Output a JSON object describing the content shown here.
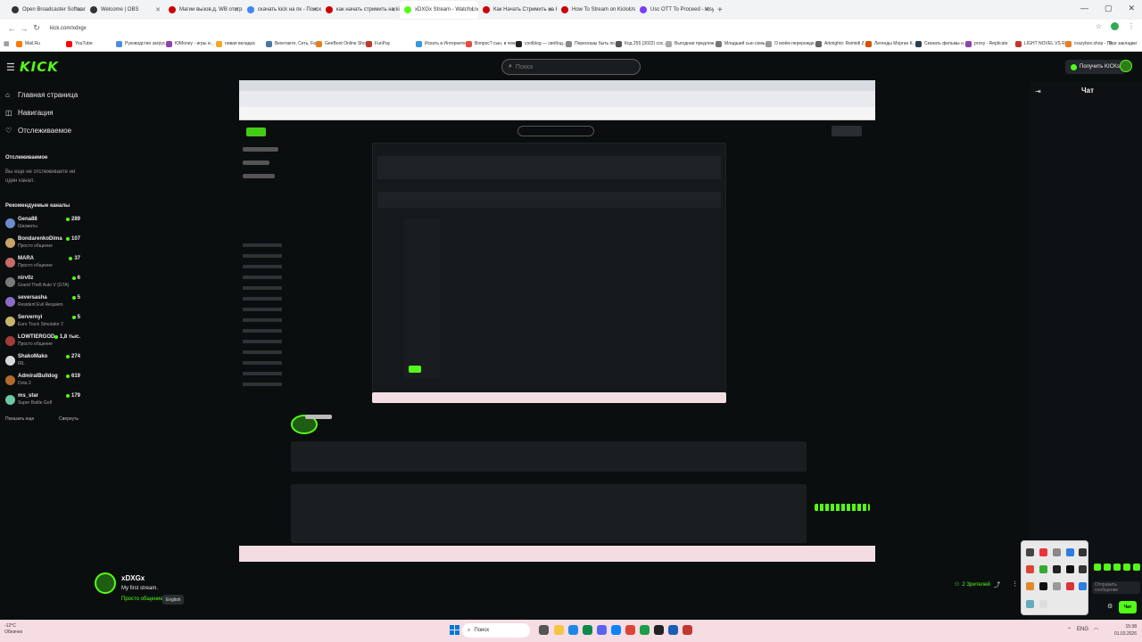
{
  "browser": {
    "tabs": [
      {
        "label": "Open Broadcaster Software | O",
        "favicon_color": "#333333"
      },
      {
        "label": "Welcome | OBS",
        "favicon_color": "#333333"
      },
      {
        "label": "Магии вызов.д. WB отстранен",
        "favicon_color": "#cc0000"
      },
      {
        "label": "скачать kick на пк - Поиск в G",
        "favicon_color": "#4285f4"
      },
      {
        "label": "как начать стримить на kick",
        "favicon_color": "#cc0000"
      },
      {
        "label": "xDXGx Stream - Watch Live",
        "favicon_color": "#53fc18",
        "active": true
      },
      {
        "label": "Как Начать Стримить на Kick",
        "favicon_color": "#cc0000"
      },
      {
        "label": "How To Stream on Kick Using",
        "favicon_color": "#cc0000"
      },
      {
        "label": "Usc OTT To Proceed - ktsyuy",
        "favicon_color": "#7a3cff"
      }
    ],
    "url": "kick.com/xdxgx",
    "bookmarks": [
      "Mail.Ru",
      "YouTube",
      "Руководство загрус...",
      "ЮMoney - игры и...",
      "новая вкладка",
      "Вконтакте, Сеть, Fa...",
      "GeeBoot Online Sho...",
      "FunPay",
      "Искать в Интернете",
      "Вопрос? сын, в чем...",
      "coolblog — свобод...",
      "Пересказы быть по...",
      "Код 255 (3022) сос...",
      "Выгодная предлож...",
      "Младший сын семь...",
      "О моём перерожде...",
      "Arknights: Reimidi Z...",
      "Легенды Морган К...",
      "Скачать фильмы н...",
      "proxy - Replicate",
      "LIGHT NOVEL VS R...",
      "crazybox.shop - По..."
    ],
    "bookmark_colors": [
      "#ff7a00",
      "#ff0000",
      "#4a90d9",
      "#8e44ad",
      "#f5a623",
      "#4a76a8",
      "#e67e22",
      "#c0392b",
      "#3498db",
      "#e74c3c",
      "#222222",
      "#888888",
      "#555555",
      "#aaaaaa",
      "#777777",
      "#999999",
      "#666666",
      "#d35400",
      "#2c3e50",
      "#8e44ad",
      "#c0392b",
      "#e67e22"
    ],
    "all_bookmarks": "Все закладки"
  },
  "kick": {
    "logo": "KICK",
    "search_placeholder": "Поиск",
    "get_kicks": "Получить KICKs",
    "accent": "#53fc18",
    "nav": [
      {
        "label": "Главная страница",
        "icon": "home-icon",
        "glyph": "⌂"
      },
      {
        "label": "Навигация",
        "icon": "compass-icon",
        "glyph": "◫"
      },
      {
        "label": "Отслеживаемое",
        "icon": "heart-icon",
        "glyph": "♡"
      }
    ],
    "following_heading": "Отслеживаемое",
    "following_empty": "Вы еще не отслеживаете ни один канал.",
    "recommended_heading": "Рекомендуемые каналы",
    "recommended": [
      {
        "name": "Gena88",
        "category": "Шахматы",
        "viewers": "289",
        "color": "#6b8cc9"
      },
      {
        "name": "BondarenkoDima",
        "category": "Просто общение",
        "viewers": "107",
        "color": "#c9a36b"
      },
      {
        "name": "MARA",
        "category": "Просто общение",
        "viewers": "37",
        "color": "#c96b6b"
      },
      {
        "name": "nirv0z",
        "category": "Grand Theft Auto V (GTA)",
        "viewers": "6",
        "color": "#7a7a7a"
      },
      {
        "name": "seversasha",
        "category": "Resident Evil Requiem",
        "viewers": "5",
        "color": "#8c6bc9"
      },
      {
        "name": "Servernyi",
        "category": "Euro Truck Simulator 2",
        "viewers": "5",
        "color": "#c9b46b"
      },
      {
        "name": "LOWTIERGOD",
        "category": "Просто общение",
        "viewers": "1,8 тыс.",
        "color": "#a33b3b"
      },
      {
        "name": "ShakoMako",
        "category": "IRL",
        "viewers": "274",
        "color": "#d9d9d9"
      },
      {
        "name": "AdmiralBulldog",
        "category": "Dota 2",
        "viewers": "619",
        "color": "#b36b2b"
      },
      {
        "name": "ms_star",
        "category": "Super Battle Golf",
        "viewers": "179",
        "color": "#6bc9a3"
      }
    ],
    "show_more": "Показать еще",
    "collapse": "Свернуть",
    "channel": {
      "name": "xDXGx",
      "title": "My first stream.",
      "category": "Просто общение",
      "language": "English",
      "viewers": "2 Зрителей"
    },
    "chat": {
      "title": "Чат",
      "input_placeholder": "Отправить сообщение",
      "send": "Чат"
    }
  },
  "taskbar": {
    "weather_temp": "-12°C",
    "weather_desc": "Облачно",
    "search": "Поиск",
    "time": "15:38",
    "date": "01.03.2026",
    "lang": "ENG"
  }
}
